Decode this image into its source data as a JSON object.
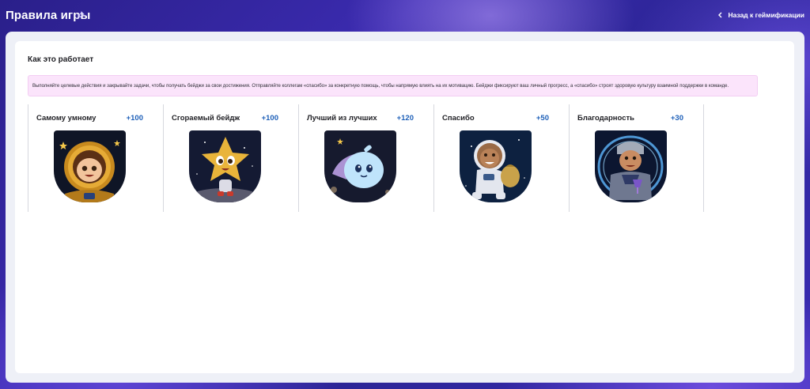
{
  "header": {
    "title": "Правила игры",
    "back_label": "Назад к геймификации"
  },
  "section": {
    "title": "Как это работает",
    "info_text": "Выполняйте целевые действия и закрывайте задачи, чтобы получать бейджи за свои достижения. Отправляйте коллегам «спасибо» за конкретную помощь, чтобы напрямую влиять на их мотивацию. Бейджи фиксируют ваш личный прогресс, а «спасибо» строят здоровую культуру взаимной поддержки в команде."
  },
  "badges": [
    {
      "name": "Самому умному",
      "points": "+100",
      "image": "astronaut-girl-gold-helmet"
    },
    {
      "name": "Сгораемый бейдж",
      "points": "+100",
      "image": "star-character"
    },
    {
      "name": "Лучший из лучших",
      "points": "+120",
      "image": "blue-comet-character"
    },
    {
      "name": "Спасибо",
      "points": "+50",
      "image": "astronaut-with-bag"
    },
    {
      "name": "Благодарность",
      "points": "+30",
      "image": "knight-with-goblet"
    }
  ],
  "colors": {
    "accent": "#1d5fb8",
    "info_bg": "#fbe4fb"
  }
}
